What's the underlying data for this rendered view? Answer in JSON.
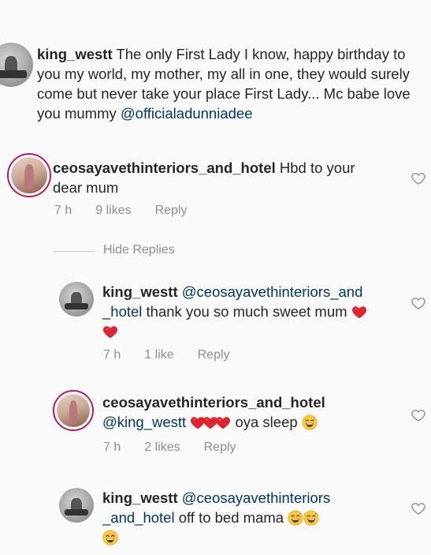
{
  "comments": [
    {
      "username": "king_westt",
      "body": "The only First Lady I know, happy birthday to you my world, my mother, my all in one, they would surely come but never take your place First Lady... Mc babe love you mummy",
      "mention": "@officialadunniadee"
    },
    {
      "username": "ceosayavethinteriors_and_hotel",
      "body": "Hbd to your dear mum",
      "time": "7 h",
      "likes": "9 likes",
      "reply": "Reply"
    }
  ],
  "hide_replies": "Hide Replies",
  "replies": [
    {
      "username": "king_westt",
      "mention_line1": "@ceosayavethinteriors_and",
      "mention_line2": "_hotel",
      "body": "thank you so much sweet mum",
      "time": "7 h",
      "likes": "1 like",
      "reply": "Reply"
    },
    {
      "username": "ceosayavethinteriors_and_hotel",
      "mention": "@king_westt",
      "body": "oya sleep",
      "time": "7 h",
      "likes": "2 likes",
      "reply": "Reply"
    },
    {
      "username": "king_westt",
      "mention_line1": "@ceosayavethinteriors",
      "mention_line2": "_and_hotel",
      "body": "off to bed mama"
    }
  ],
  "colors": {
    "heart_red": "#e0242f",
    "mention_blue": "#00376b",
    "meta_gray": "#8e8e8e",
    "story_ring": "#c2185b"
  },
  "icons": [
    "heart-outline-icon",
    "red-heart-emoji",
    "grinning-sweat-emoji",
    "beaming-face-emoji"
  ]
}
